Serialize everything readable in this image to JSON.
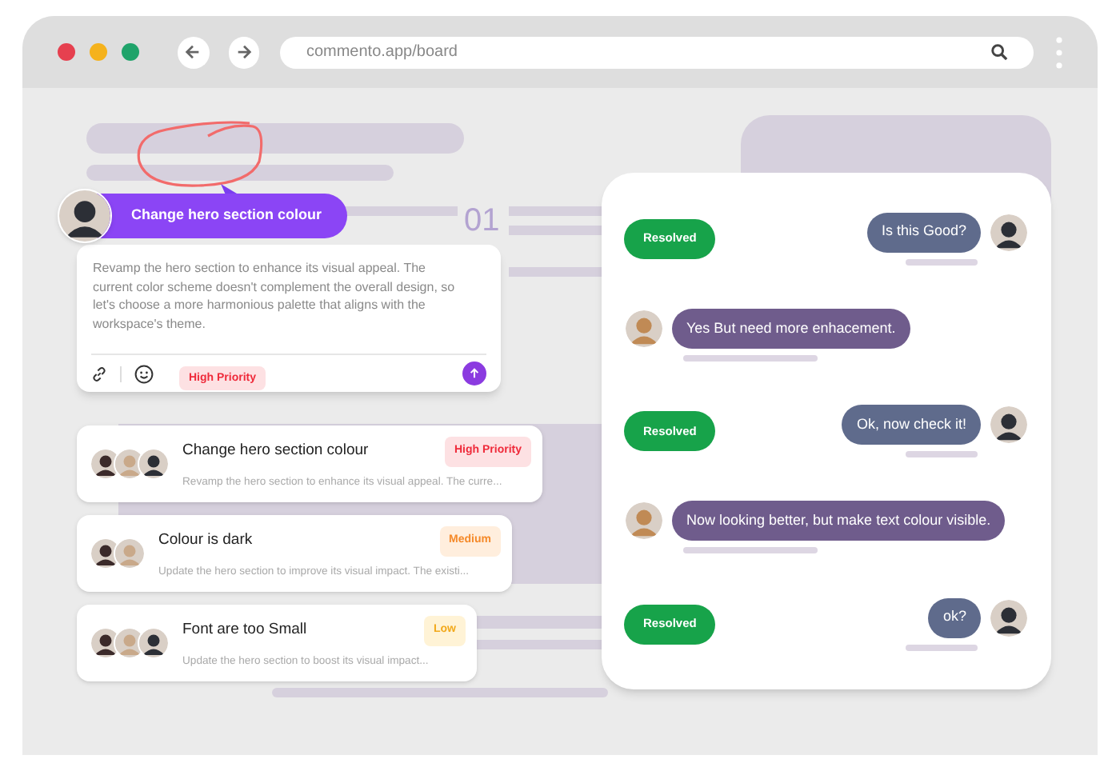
{
  "browser": {
    "url": "commento.app/board"
  },
  "canvas": {
    "section_number": "01"
  },
  "comment": {
    "title": "Change hero section colour",
    "body": "Revamp the hero section to enhance its visual appeal. The current color scheme doesn't complement the overall design, so let's choose a more harmonious palette that aligns with the workspace's theme.",
    "priority": {
      "label": "High Priority",
      "kind": "high"
    }
  },
  "tasks": [
    {
      "title": "Change hero section colour",
      "summary": "Revamp the hero section to enhance its visual appeal. The curre...",
      "priority": {
        "label": "High Priority",
        "kind": "high"
      },
      "avatars": [
        {
          "kind": "dark"
        },
        {
          "kind": "light"
        },
        {
          "kind": "hat"
        }
      ]
    },
    {
      "title": "Colour is dark",
      "summary": "Update the hero section to improve its visual impact. The existi...",
      "priority": {
        "label": "Medium",
        "kind": "medium"
      },
      "avatars": [
        {
          "kind": "dark"
        },
        {
          "kind": "light"
        }
      ]
    },
    {
      "title": "Font are too Small",
      "summary": "Update the hero section to boost its visual impact...",
      "priority": {
        "label": "Low",
        "kind": "low"
      },
      "avatars": [
        {
          "kind": "dark"
        },
        {
          "kind": "light"
        },
        {
          "kind": "hat"
        }
      ]
    }
  ],
  "chat": [
    {
      "kind": "outgoing",
      "text": "Is this Good?",
      "action": "Resolved"
    },
    {
      "kind": "incoming",
      "text": "Yes But need more enhacement."
    },
    {
      "kind": "outgoing",
      "text": "Ok, now check it!",
      "action": "Resolved"
    },
    {
      "kind": "incoming",
      "text": "Now looking better, but make text colour visible."
    },
    {
      "kind": "outgoing",
      "text": "ok?",
      "action": "Resolved"
    }
  ]
}
